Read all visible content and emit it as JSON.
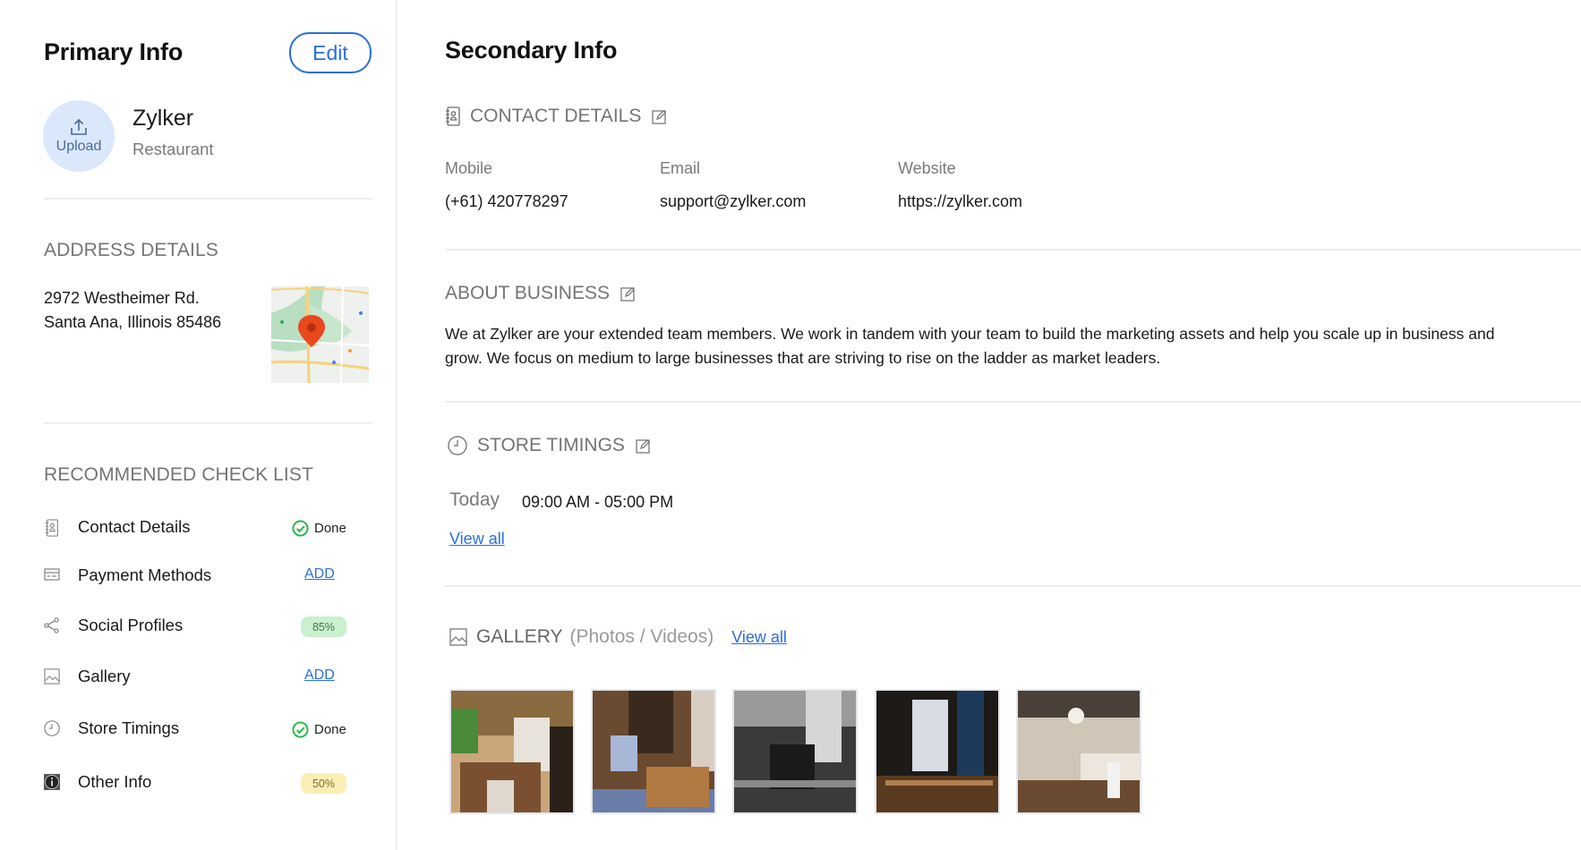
{
  "primary": {
    "title": "Primary Info",
    "edit_label": "Edit",
    "upload_label": "Upload",
    "business_name": "Zylker",
    "business_type": "Restaurant",
    "address": {
      "title": "ADDRESS DETAILS",
      "line1": "2972 Westheimer Rd.",
      "line2": "Santa Ana, Illinois 85486"
    },
    "checklist": {
      "title": "RECOMMENDED CHECK LIST",
      "items": [
        {
          "label": "Contact Details",
          "icon": "contact-book-icon",
          "status_type": "done",
          "status": "Done"
        },
        {
          "label": "Payment Methods",
          "icon": "payment-card-icon",
          "status_type": "add",
          "status": "ADD"
        },
        {
          "label": "Social Profiles",
          "icon": "share-icon",
          "status_type": "progress",
          "status": "85%",
          "progress": 85,
          "color": "#c9f0cf"
        },
        {
          "label": "Gallery",
          "icon": "image-icon",
          "status_type": "add",
          "status": "ADD"
        },
        {
          "label": "Store Timings",
          "icon": "clock-icon",
          "status_type": "done",
          "status": "Done"
        },
        {
          "label": "Other Info",
          "icon": "info-icon",
          "status_type": "progress",
          "status": "50%",
          "progress": 50,
          "color": "#fbeeb5"
        }
      ]
    }
  },
  "secondary": {
    "title": "Secondary Info",
    "contact": {
      "title": "CONTACT DETAILS",
      "fields": [
        {
          "label": "Mobile",
          "value": "(+61) 420778297"
        },
        {
          "label": "Email",
          "value": "support@zylker.com"
        },
        {
          "label": "Website",
          "value": "https://zylker.com"
        }
      ]
    },
    "about": {
      "title": "ABOUT BUSINESS",
      "text": "We at Zylker are your extended team members. We work in tandem with your team to build the marketing assets and help you scale up in business and grow. We focus on medium to large businesses that are striving to rise on the ladder as market leaders."
    },
    "timings": {
      "title": "STORE TIMINGS",
      "day": "Today",
      "hours": "09:00 AM - 05:00 PM",
      "view_all": "View all"
    },
    "gallery": {
      "title": "GALLERY",
      "subtitle": "(Photos / Videos)",
      "view_all": "View all",
      "thumbnails": [
        "restaurant-photo-1",
        "restaurant-photo-2",
        "restaurant-photo-3",
        "restaurant-photo-4",
        "restaurant-photo-5"
      ]
    }
  },
  "colors": {
    "accent": "#2a6fdb",
    "done": "#1fb83f",
    "muted": "#757575"
  }
}
